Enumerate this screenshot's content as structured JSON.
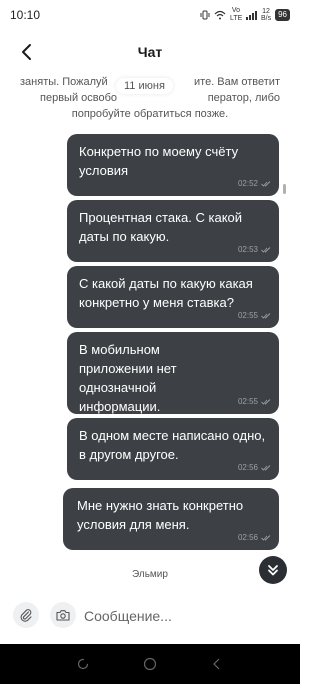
{
  "status_bar": {
    "time": "10:10",
    "network_label": "Vo LTE",
    "speed_value": "12",
    "speed_unit": "B/s",
    "battery": "96"
  },
  "header": {
    "title": "Чат"
  },
  "chat": {
    "system_message": "заняты. Пожалуй... ите. Вам ответит первый освобо... ператор, либо попробуйте обратиться позже.",
    "system_line_1": "заняты. Пожалуй",
    "system_line_1_end": "ите. Вам ответит",
    "system_line_2": "первый освобо",
    "system_line_2_end": "ператор, либо",
    "system_line_3": "попробуйте обратиться позже.",
    "date_divider": "11 июня",
    "messages": [
      {
        "text": "Конкретно по моему счёту условия",
        "time": "02:52",
        "status": "read"
      },
      {
        "text": "Процентная стака. С какой даты по какую.",
        "time": "02:53",
        "status": "read"
      },
      {
        "text": "С какой даты по какую какая конкретно у меня ставка?",
        "time": "02:55",
        "status": "read"
      },
      {
        "text": "В мобильном приложении нет однозначной информации.",
        "time": "02:55",
        "status": "read"
      },
      {
        "text": "В одном месте написано одно, в другом другое.",
        "time": "02:56",
        "status": "read"
      },
      {
        "text": "Мне нужно знать конкретно условия для меня.",
        "time": "02:56",
        "status": "read"
      }
    ],
    "sender_name": "Эльмир"
  },
  "input": {
    "placeholder": "Сообщение..."
  },
  "colors": {
    "bubble_bg": "#3d4146",
    "bubble_text": "#ffffff",
    "meta_text": "#9aa0a6",
    "nav_bg": "#000000"
  },
  "icons": {
    "back": "chevron-left-icon",
    "attach": "paperclip-icon",
    "camera": "camera-icon",
    "scroll_down": "double-chevron-down-icon",
    "read_status": "double-check-icon"
  }
}
